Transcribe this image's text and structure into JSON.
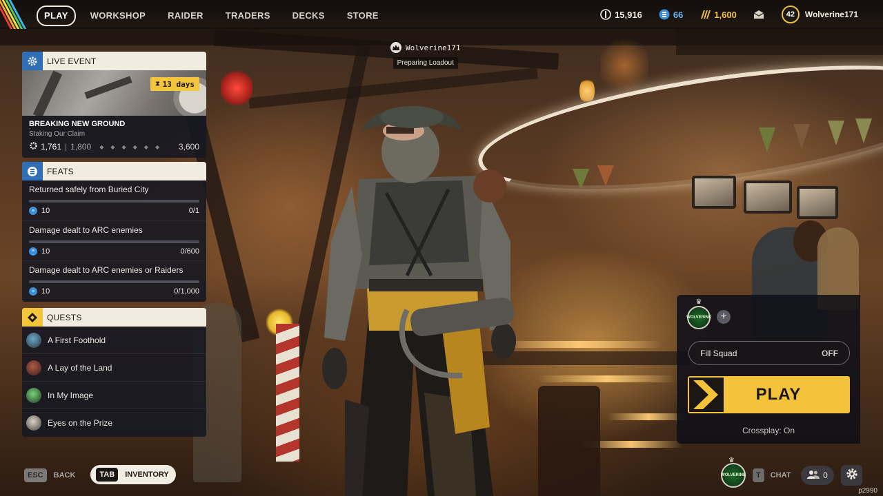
{
  "nav": {
    "items": [
      "PLAY",
      "WORKSHOP",
      "RAIDER",
      "TRADERS",
      "DECKS",
      "STORE"
    ],
    "active_index": 0
  },
  "currencies": {
    "coins": "15,916",
    "tokens": "66",
    "credits": "1,600"
  },
  "profile": {
    "level": "42",
    "username": "Wolverine171"
  },
  "loadout": {
    "player": "Wolverine171",
    "status": "Preparing Loadout"
  },
  "live_event": {
    "header": "LIVE EVENT",
    "days_left": "13 days",
    "title": "BREAKING NEW GROUND",
    "subtitle": "Staking Our Claim",
    "progress_current": "1,761",
    "progress_next": "1,800",
    "progress_max": "3,600",
    "progress_fraction": 0.489
  },
  "feats": {
    "header": "FEATS",
    "items": [
      {
        "title": "Returned safely from Buried City",
        "reward": "10",
        "progress": "0/1",
        "fraction": 0
      },
      {
        "title": "Damage dealt to ARC enemies",
        "reward": "10",
        "progress": "0/600",
        "fraction": 0
      },
      {
        "title": "Damage dealt to ARC enemies or Raiders",
        "reward": "10",
        "progress": "0/1,000",
        "fraction": 0
      }
    ]
  },
  "quests": {
    "header": "QUESTS",
    "items": [
      {
        "title": "A First Foothold"
      },
      {
        "title": "A Lay of the Land"
      },
      {
        "title": "In My Image"
      },
      {
        "title": "Eyes on the Prize"
      }
    ]
  },
  "controls": {
    "esc_key": "ESC",
    "back_label": "BACK",
    "tab_key": "TAB",
    "inventory_label": "INVENTORY"
  },
  "squad": {
    "avatar_text": "WOLVERINE",
    "fill_squad_label": "Fill Squad",
    "fill_squad_value": "OFF",
    "play_label": "PLAY",
    "crossplay": "Crossplay: On"
  },
  "bottom_right": {
    "chat_key": "T",
    "chat_label": "CHAT",
    "friends_count": "0",
    "build": "p2990"
  },
  "colors": {
    "accent_yellow": "#f5c33b",
    "panel_header": "#f2ece0",
    "panel_body": "#161822",
    "event_icon_bg": "#3a8fd8"
  }
}
